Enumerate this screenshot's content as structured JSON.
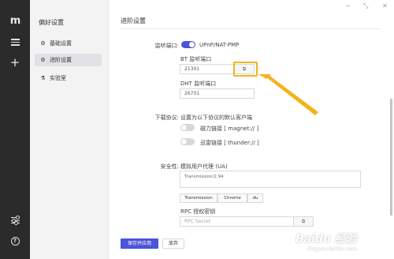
{
  "rail": {
    "logo": "m",
    "plus": "+",
    "help": "?"
  },
  "sidebar": {
    "title": "偏好设置",
    "items": [
      {
        "label": "基础设置",
        "icon": "gear-icon",
        "glyph": "⚙"
      },
      {
        "label": "进阶设置",
        "icon": "sliders-icon",
        "glyph": "⚙"
      },
      {
        "label": "实验室",
        "icon": "flask-icon",
        "glyph": "⚗"
      }
    ],
    "active_index": 1
  },
  "window": {
    "minimize": "−",
    "restore": "⤡",
    "close": "✕"
  },
  "main": {
    "title": "进阶设置",
    "listen_port": {
      "label": "监听端口:",
      "upnp_label": "UPnP/NAT-PMP",
      "upnp_on": true,
      "bt_label": "BT 监听端口",
      "bt_value": "21301",
      "dht_label": "DHT 监听端口",
      "dht_value": "26701"
    },
    "protocol": {
      "label": "下载协议:",
      "desc": "设置为以下协议的默认客户端",
      "magnet_label": "磁力链接 [ magnet:// ]",
      "magnet_on": false,
      "thunder_label": "迅雷链接 [ thunder:// ]",
      "thunder_on": false
    },
    "security": {
      "label": "安全性:",
      "ua_label": "模拟用户代理 (UA)",
      "ua_value": "Transmission/2.94",
      "presets": [
        "Transmission",
        "Chrome",
        "du"
      ],
      "rpc_label": "RPC 授权密钥",
      "rpc_placeholder": "RPC Secret"
    },
    "save_label": "保存并应用",
    "discard_label": "放弃"
  },
  "accent_color": "#4a55d8",
  "highlight_color": "#f5b31b",
  "watermark": {
    "main": "Baidu 经验",
    "sub": "jingyan.baidu.com"
  }
}
